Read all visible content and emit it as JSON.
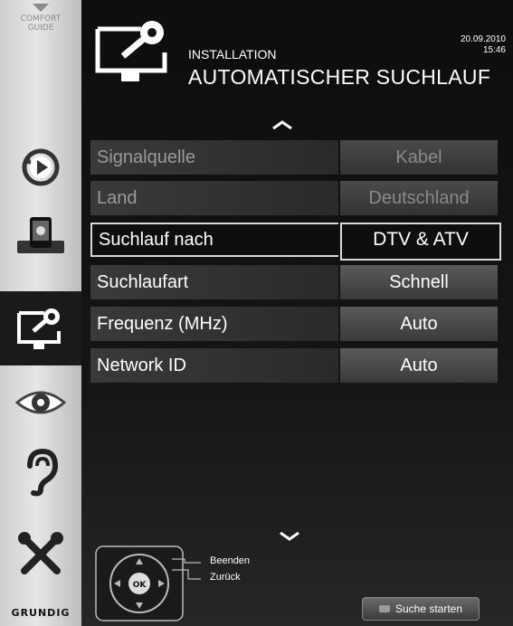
{
  "sidebar": {
    "comfort_line1": "COMFORT",
    "comfort_line2": "GUIDE",
    "items": [
      {
        "icon": "source-icon"
      },
      {
        "icon": "mobile-icon"
      },
      {
        "icon": "installation-icon",
        "active": true
      },
      {
        "icon": "picture-icon"
      },
      {
        "icon": "sound-icon"
      },
      {
        "icon": "settings-icon"
      }
    ],
    "brand": "GRUNDIG"
  },
  "header": {
    "section": "INSTALLATION",
    "title": "AUTOMATISCHER SUCHLAUF",
    "date": "20.09.2010",
    "time": "15:46"
  },
  "menu": {
    "rows": [
      {
        "label": "Signalquelle",
        "value": "Kabel",
        "state": "dim"
      },
      {
        "label": "Land",
        "value": "Deutschland",
        "state": "dim"
      },
      {
        "label": "Suchlauf nach",
        "value": "DTV & ATV",
        "state": "selected"
      },
      {
        "label": "Suchlaufart",
        "value": "Schnell",
        "state": "normal"
      },
      {
        "label": "Frequenz (MHz)",
        "value": "Auto",
        "state": "normal"
      },
      {
        "label": "Network ID",
        "value": "Auto",
        "state": "normal"
      }
    ]
  },
  "footer": {
    "ok_label": "OK",
    "exit_label": "Beenden",
    "back_label": "Zurück",
    "start_button": "Suche starten"
  },
  "colors": {
    "background": "#111111",
    "sidebar": "#d9d9d9",
    "selected_border": "#d8d8d8"
  }
}
